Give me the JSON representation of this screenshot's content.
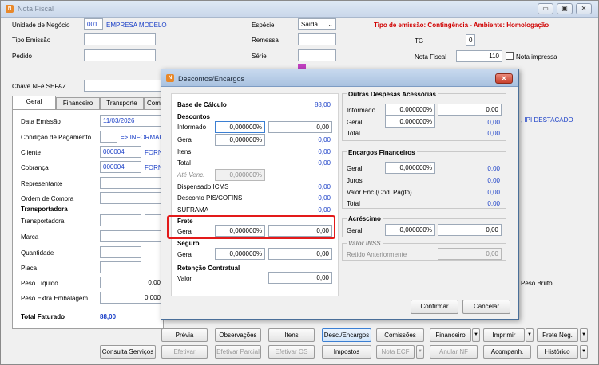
{
  "window": {
    "title": "Nota Fiscal",
    "controls": [
      "▭",
      "▣",
      "✕"
    ]
  },
  "header": {
    "unidade_label": "Unidade de Negócio",
    "unidade_code": "001",
    "unidade_name": "EMPRESA MODELO",
    "tipo_emissao_label": "Tipo Emissão",
    "pedido_label": "Pedido",
    "especie_label": "Espécie",
    "especie_value": "Saída",
    "remessa_label": "Remessa",
    "serie_label": "Série",
    "status_text": "Tipo de emissão: Contingência - Ambiente: Homologação",
    "tg_label": "TG",
    "tg_value": "0",
    "nota_fiscal_label": "Nota Fiscal",
    "nota_fiscal_value": "110",
    "nota_impressa_label": "Nota impressa",
    "chave_label": "Chave NFe SEFAZ",
    "ipi_text": ", IPI DESTACADO",
    "peso_bruto_label": "Peso Bruto"
  },
  "tabs": [
    "Geral",
    "Financeiro",
    "Transporte",
    "Comp"
  ],
  "geral": {
    "data_emissao_label": "Data Emissão",
    "data_emissao_value": "11/03/2026",
    "condicao_label": "Condição de Pagamento",
    "condicao_link": "=> INFORMAR",
    "cliente_label": "Cliente",
    "cliente_code": "000004",
    "cliente_name": "FORN",
    "cobranca_label": "Cobrança",
    "cobranca_code": "000004",
    "cobranca_name": "FORN",
    "representante_label": "Representante",
    "ordem_label": "Ordem de Compra",
    "transportadora_header": "Transportadora",
    "transportadora_label": "Transportadora",
    "marca_label": "Marca",
    "quantidade_label": "Quantidade",
    "placa_label": "Placa",
    "peso_liquido_label": "Peso Líquido",
    "peso_liquido_value": "0,00",
    "peso_extra_label": "Peso Extra Embalagem",
    "peso_extra_value": "0,000",
    "total_faturado_label": "Total Faturado",
    "total_faturado_value": "88,00"
  },
  "dialog": {
    "title": "Descontos/Encargos",
    "base_calculo_label": "Base de Cálculo",
    "base_calculo_value": "88,00",
    "descontos_header": "Descontos",
    "informado_label": "Informado",
    "informado_pct": "0,000000%",
    "informado_value": "0,00",
    "geral_label": "Geral",
    "geral_pct": "0,000000%",
    "geral_value": "0,00",
    "itens_label": "Itens",
    "itens_value": "0,00",
    "total_label": "Total",
    "total_value": "0,00",
    "ate_venc_label": "Até Venc.",
    "ate_venc_pct": "0,000000%",
    "dispensado_icms_label": "Dispensado ICMS",
    "dispensado_icms_value": "0,00",
    "desconto_pis_label": "Desconto PIS/COFINS",
    "desconto_pis_value": "0,00",
    "suframa_label": "SUFRAMA",
    "suframa_value": "0,00",
    "frete_header": "Frete",
    "frete_geral_label": "Geral",
    "frete_pct": "0,000000%",
    "frete_value": "0,00",
    "seguro_header": "Seguro",
    "seguro_geral_label": "Geral",
    "seguro_pct": "0,000000%",
    "seguro_value": "0,00",
    "retencao_header": "Retenção Contratual",
    "retencao_valor_label": "Valor",
    "retencao_value": "0,00",
    "outras_header": "Outras Despesas Acessórias",
    "outras_informado_label": "Informado",
    "outras_informado_pct": "0,000000%",
    "outras_informado_value": "0,00",
    "outras_geral_label": "Geral",
    "outras_geral_pct": "0,000000%",
    "outras_geral_value": "0,00",
    "outras_total_label": "Total",
    "outras_total_value": "0,00",
    "encargos_header": "Encargos Financeiros",
    "enc_geral_label": "Geral",
    "enc_geral_pct": "0,000000%",
    "enc_geral_value": "0,00",
    "enc_juros_label": "Juros",
    "enc_juros_value": "0,00",
    "enc_valor_label": "Valor Enc.(Cnd. Pagto)",
    "enc_valor_value": "0,00",
    "enc_total_label": "Total",
    "enc_total_value": "0,00",
    "acrescimo_header": "Acréscimo",
    "acr_geral_label": "Geral",
    "acr_pct": "0,000000%",
    "acr_value": "0,00",
    "inss_header": "Valor INSS",
    "inss_label": "Retido Anteriormente",
    "inss_value": "0,00",
    "confirmar_label": "Confirmar",
    "cancelar_label": "Cancelar"
  },
  "buttons_row1": [
    "Prévia",
    "Observações",
    "Itens",
    "Desc./Encargos",
    "Comissões",
    "Financeiro",
    "Imprimir",
    "Frete Neg."
  ],
  "buttons_row2": [
    "Consulta Serviços",
    "Efetivar",
    "Efetivar Parcial",
    "Efetivar OS",
    "Impostos",
    "Nota ECF",
    "Anular NF",
    "Acompanh.",
    "Histórico"
  ]
}
